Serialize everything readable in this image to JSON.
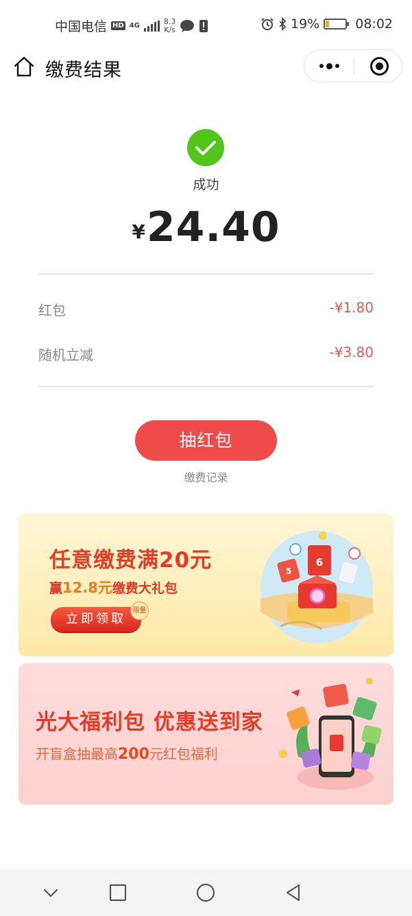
{
  "status_bar": {
    "carrier": "中国电信",
    "hd": "HD",
    "network": "4G",
    "speed_value": "8.3",
    "speed_unit": "K/s",
    "battery_percent": "19%",
    "battery_level": 0.19,
    "time": "08:02"
  },
  "nav": {
    "title": "缴费结果"
  },
  "result": {
    "status": "成功",
    "currency": "¥",
    "amount": "24.40"
  },
  "discounts": [
    {
      "label": "红包",
      "value": "-¥1.80"
    },
    {
      "label": "随机立减",
      "value": "-¥3.80"
    }
  ],
  "actions": {
    "draw_button": "抽红包",
    "record_link": "缴费记录"
  },
  "banner1": {
    "title": "任意缴费满20元",
    "sub_prefix": "赢",
    "sub_highlight": "12.8元",
    "sub_suffix": "缴费大礼包",
    "button": "立即领取",
    "badge": "限量"
  },
  "banner2": {
    "title": "光大福利包 优惠送到家",
    "sub_prefix": "开盲盒抽最高",
    "sub_highlight": "200",
    "sub_suffix": "元红包福利"
  },
  "colors": {
    "success": "#52c41a",
    "accent_red": "#ef4b4a",
    "discount_red": "#e25a4e"
  }
}
